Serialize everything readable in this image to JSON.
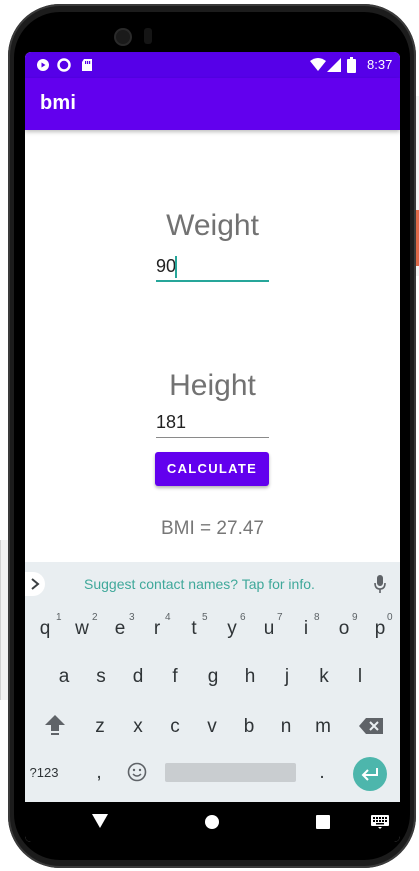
{
  "status_bar": {
    "time": "8:37"
  },
  "app_bar": {
    "title": "bmi"
  },
  "form": {
    "weight_label": "Weight",
    "weight_value": "90",
    "height_label": "Height",
    "height_value": "181",
    "calculate_label": "CALCULATE",
    "result_text": "BMI = 27.47"
  },
  "keyboard": {
    "suggestion": "Suggest contact names? Tap for info.",
    "row1": [
      "q",
      "w",
      "e",
      "r",
      "t",
      "y",
      "u",
      "i",
      "o",
      "p"
    ],
    "row1_hints": [
      "1",
      "2",
      "3",
      "4",
      "5",
      "6",
      "7",
      "8",
      "9",
      "0"
    ],
    "row2": [
      "a",
      "s",
      "d",
      "f",
      "g",
      "h",
      "j",
      "k",
      "l"
    ],
    "row3": [
      "z",
      "x",
      "c",
      "v",
      "b",
      "n",
      "m"
    ],
    "symbols_label": "?123",
    "comma": ",",
    "period": "."
  },
  "colors": {
    "primary": "#6200ee",
    "status": "#5600e8",
    "accent": "#26a69a",
    "enter": "#4db6ac"
  }
}
